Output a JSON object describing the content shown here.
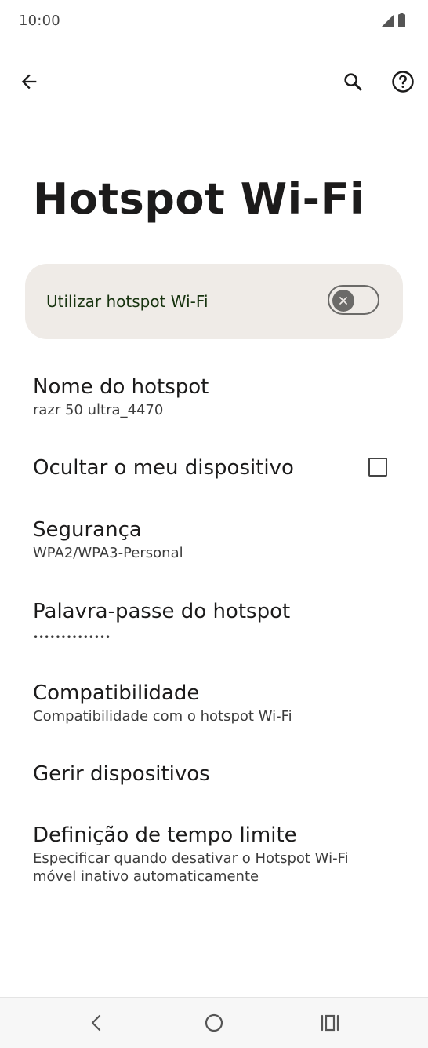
{
  "status_bar": {
    "time": "10:00",
    "icons": [
      "signal-icon",
      "battery-icon"
    ]
  },
  "app_bar": {
    "icons": [
      "back-arrow-icon",
      "search-icon",
      "help-icon"
    ]
  },
  "page": {
    "title": "Hotspot Wi-Fi"
  },
  "main_switch": {
    "label": "Utilizar hotspot Wi-Fi",
    "state": "off"
  },
  "settings": [
    {
      "title": "Nome do hotspot",
      "subtitle": "razr 50 ultra_4470"
    },
    {
      "title": "Ocultar o meu dispositivo",
      "checked": false
    },
    {
      "title": "Segurança",
      "subtitle": "WPA2/WPA3-Personal"
    },
    {
      "title": "Palavra-passe do hotspot",
      "subtitle": "••••••••••••••"
    },
    {
      "title": "Compatibilidade",
      "subtitle": "Compatibilidade com o hotspot Wi-Fi"
    },
    {
      "title": "Gerir dispositivos"
    },
    {
      "title": "Definição de tempo limite",
      "subtitle": "Especificar quando desativar o Hotspot Wi-Fi móvel inativo automaticamente"
    }
  ],
  "nav_bar": {
    "icons": [
      "nav-back-icon",
      "nav-home-icon",
      "nav-recents-icon"
    ]
  },
  "colors": {
    "switch_card_bg": "#efebe7",
    "switch_label": "#17330f",
    "toggle_off": "#6b6a68"
  }
}
